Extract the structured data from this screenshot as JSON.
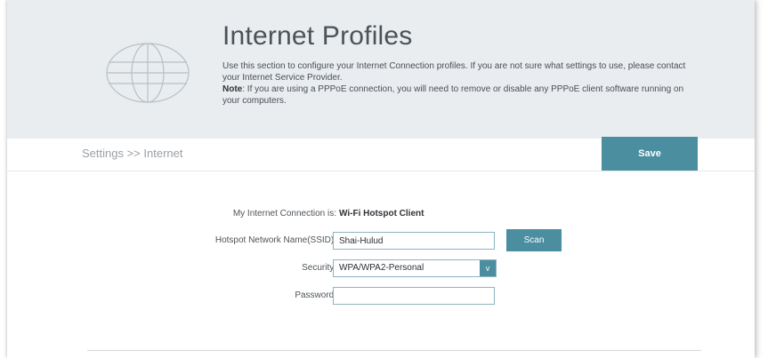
{
  "header": {
    "title": "Internet Profiles",
    "description": "Use this section to configure your Internet Connection profiles. If you are not sure what settings to use, please contact your Internet Service Provider.",
    "note_label": "Note",
    "note_text": ": If you are using a PPPoE connection, you will need to remove or disable any PPPoE client software running on your computers.",
    "icon": "globe-icon"
  },
  "toolbar": {
    "breadcrumb": "Settings >> Internet",
    "save_label": "Save"
  },
  "form": {
    "connection_label": "My Internet Connection is:",
    "connection_value": "Wi-Fi Hotspot Client",
    "ssid_label": "Hotspot Network Name(SSID):",
    "ssid_value": "Shai-Hulud",
    "scan_label": "Scan",
    "security_label": "Security:",
    "security_value": "WPA/WPA2-Personal",
    "security_arrow": "v",
    "password_label": "Password:",
    "password_value": ""
  },
  "colors": {
    "accent": "#4a8ea0",
    "header_bg": "#e9edf0"
  }
}
